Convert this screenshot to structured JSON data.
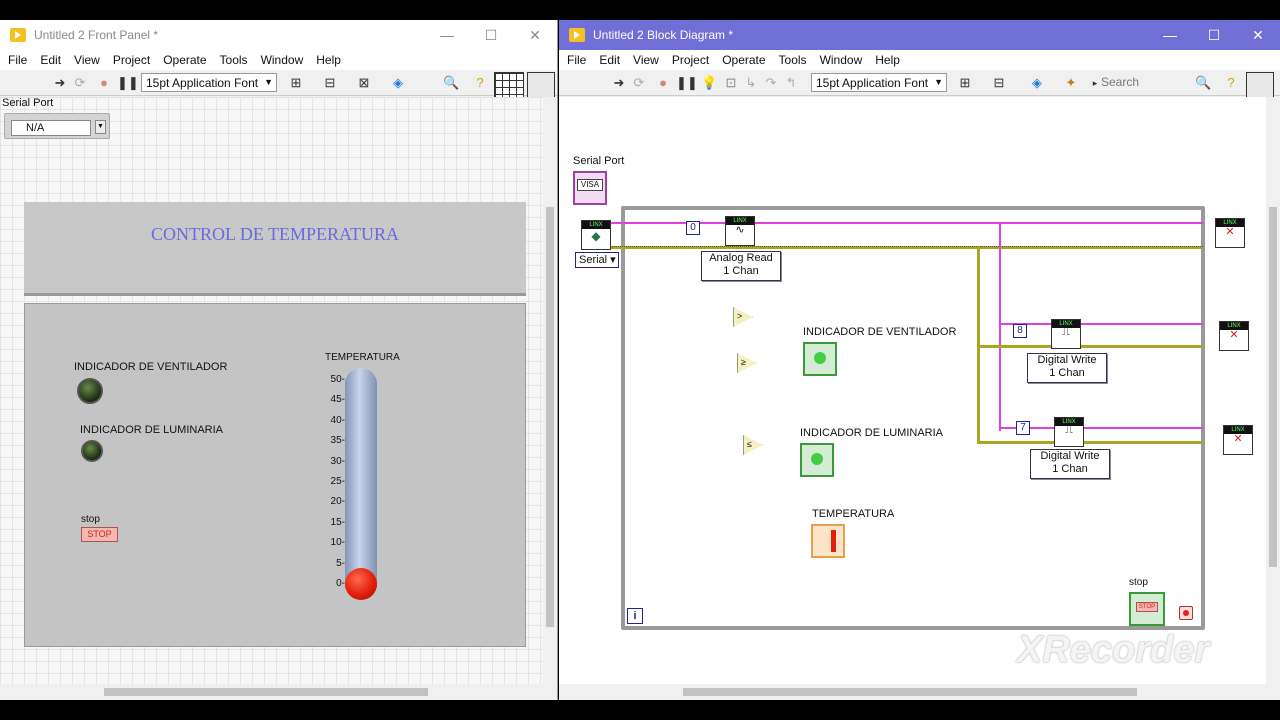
{
  "front_panel": {
    "title": "Untitled 2 Front Panel *",
    "menu": [
      "File",
      "Edit",
      "View",
      "Project",
      "Operate",
      "Tools",
      "Window",
      "Help"
    ],
    "font_selector": "15pt Application Font",
    "serial_port_label": "Serial Port",
    "serial_port_value": "N/A",
    "header_text": "CONTROL DE TEMPERATURA",
    "led_vent_label": "INDICADOR DE VENTILADOR",
    "led_lum_label": "INDICADOR DE LUMINARIA",
    "stop_label": "stop",
    "stop_button": "STOP",
    "thermo_label": "TEMPERATURA",
    "thermo_scale": [
      "50-",
      "45-",
      "40-",
      "35-",
      "30-",
      "25-",
      "20-",
      "15-",
      "10-",
      "5-",
      "0-"
    ],
    "thermo_value": 0,
    "thermo_max": 50
  },
  "block_diagram": {
    "title": "Untitled 2 Block Diagram *",
    "menu": [
      "File",
      "Edit",
      "View",
      "Project",
      "Operate",
      "Tools",
      "Window",
      "Help"
    ],
    "font_selector": "15pt Application Font",
    "search_placeholder": "Search",
    "serial_port_label": "Serial Port",
    "visa_text": "VISA",
    "serial_selector": "Serial",
    "analog_read": [
      "Analog Read",
      "1 Chan"
    ],
    "digital_write_1": [
      "Digital Write",
      "1 Chan"
    ],
    "digital_write_2": [
      "Digital Write",
      "1 Chan"
    ],
    "const_0": "0",
    "const_8": "8",
    "const_7": "7",
    "vent_label": "INDICADOR DE VENTILADOR",
    "lum_label": "INDICADOR DE LUMINARIA",
    "temp_label": "TEMPERATURA",
    "stop_label": "stop",
    "stop_button": "STOP",
    "iteration": "i",
    "linx_text": "LINX",
    "cmp_gt": ">",
    "cmp_ge": "≥",
    "cmp_le": "≤"
  },
  "watermark": "XRecorder",
  "colors": {
    "accent_title": "#6f6fd6",
    "pink_wire": "#e040e0",
    "yellow_wire": "#a0a020",
    "thermo_fill": "#e41e0c",
    "header_text": "#6a6ae0"
  }
}
